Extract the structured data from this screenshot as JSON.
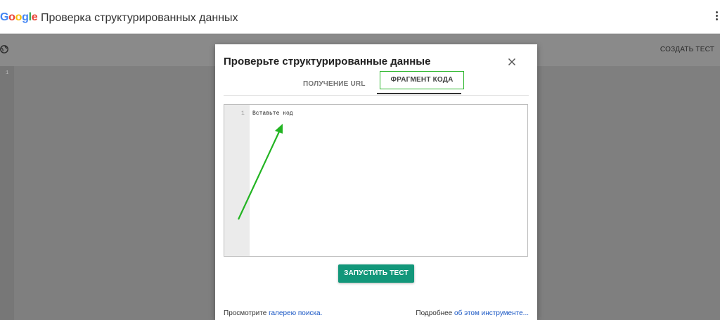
{
  "header": {
    "logo_letters": [
      {
        "ch": "G",
        "color": "#4285F4"
      },
      {
        "ch": "o",
        "color": "#EA4335"
      },
      {
        "ch": "o",
        "color": "#FBBC05"
      },
      {
        "ch": "g",
        "color": "#4285F4"
      },
      {
        "ch": "l",
        "color": "#34A853"
      },
      {
        "ch": "e",
        "color": "#EA4335"
      }
    ],
    "title": "Проверка структурированных данных"
  },
  "subbar": {
    "create_test_label": "СОЗДАТЬ ТЕСТ",
    "line_number": "1"
  },
  "dialog": {
    "title": "Проверьте структурированные данные",
    "tabs": [
      {
        "label": "ПОЛУЧЕНИЕ URL",
        "active": false
      },
      {
        "label": "ФРАГМЕНТ КОДА",
        "active": true
      }
    ],
    "editor": {
      "line_number": "1",
      "placeholder_text": "Вставьте код"
    },
    "run_button_label": "ЗАПУСТИТЬ ТЕСТ",
    "footer": {
      "left_prefix": "Просмотрите ",
      "left_link": "галерею поиска.",
      "right_prefix": "Подробнее ",
      "right_link": "об этом инструменте..."
    }
  },
  "colors": {
    "accent_button": "#12977a",
    "highlight_box": "#2eb72e",
    "arrow": "#22b422",
    "link": "#1a57c4"
  }
}
